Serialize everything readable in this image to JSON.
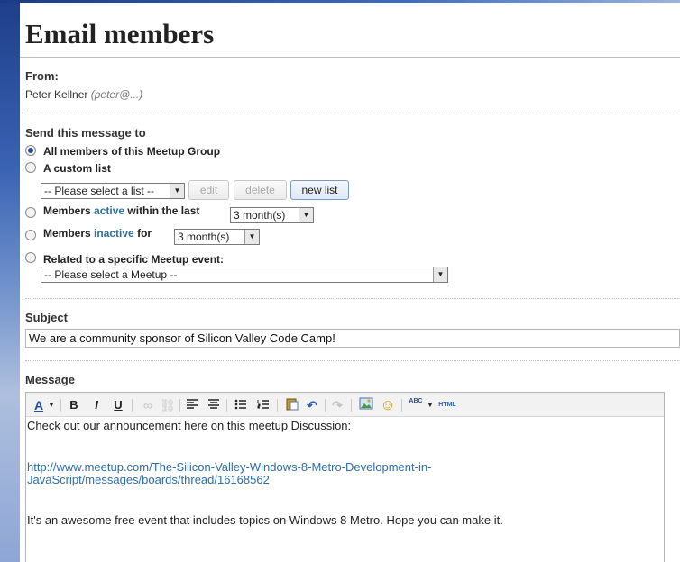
{
  "page": {
    "title": "Email members"
  },
  "from": {
    "label": "From:",
    "name": "Peter Kellner",
    "email": "(peter@...)"
  },
  "send_to": {
    "heading": "Send this message to",
    "options": {
      "all": "All members of this Meetup Group",
      "custom": "A custom list",
      "active_pre": "Members ",
      "active_word": "active",
      "active_post": " within the last",
      "inactive_pre": "Members ",
      "inactive_word": "inactive",
      "inactive_post": " for",
      "event": "Related to a specific Meetup event:"
    },
    "list_select": "-- Please select a list --",
    "buttons": {
      "edit": "edit",
      "delete": "delete",
      "new_list": "new list"
    },
    "active_period": "3 month(s)",
    "inactive_period": "3 month(s)",
    "meetup_select": "-- Please select a Meetup --"
  },
  "subject": {
    "label": "Subject",
    "value": "We are a community sponsor of Silicon Valley Code Camp!"
  },
  "message": {
    "label": "Message",
    "toolbar": {
      "font_color": "A",
      "bold": "B",
      "italic": "I",
      "underline": "U",
      "undo": "↶",
      "redo": "↷",
      "smiley": "☺",
      "spell": "ABC",
      "html": "HTML"
    },
    "lines": [
      "Check out our announcement here on this meetup Discussion:",
      "http://www.meetup.com/The-Silicon-Valley-Windows-8-Metro-Development-in-",
      "JavaScript/messages/boards/thread/16168562",
      "It's an awesome free event that includes topics on Windows 8 Metro.  Hope you can make it."
    ]
  },
  "colors": {
    "accent": "#2f6f9e",
    "link": "#2c6ea8",
    "title": "#222222"
  }
}
